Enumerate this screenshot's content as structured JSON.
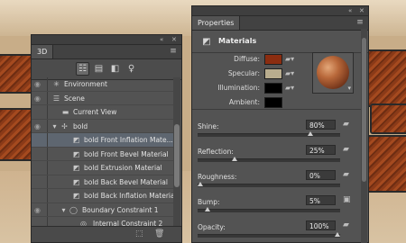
{
  "panel_3d": {
    "tab": "3D",
    "rows": [
      {
        "label": "Environment",
        "icon": "environment-icon",
        "indent": 0
      },
      {
        "label": "Scene",
        "icon": "scene-icon",
        "indent": 0
      },
      {
        "label": "Current View",
        "icon": "camera-icon",
        "indent": 1
      },
      {
        "label": "bold",
        "icon": "mesh-icon",
        "indent": 1
      },
      {
        "label": "bold Front Inflation Mate...",
        "icon": "material-icon",
        "indent": 2
      },
      {
        "label": "bold Front Bevel Material",
        "icon": "material-icon",
        "indent": 2
      },
      {
        "label": "bold Extrusion Material",
        "icon": "material-icon",
        "indent": 2
      },
      {
        "label": "bold Back Bevel Material",
        "icon": "material-icon",
        "indent": 2
      },
      {
        "label": "bold Back Inflation Material",
        "icon": "material-icon",
        "indent": 2
      },
      {
        "label": "Boundary Constraint 1",
        "icon": "constraint-icon",
        "indent": 1
      },
      {
        "label": "Internal Constraint 2",
        "icon": "constraint-icon",
        "indent": 2
      }
    ]
  },
  "properties": {
    "tab": "Properties",
    "title": "Materials",
    "swatches": [
      {
        "label": "Diffuse:",
        "color": "#8b2d10"
      },
      {
        "label": "Specular:",
        "color": "#b9ad8e"
      },
      {
        "label": "Illumination:",
        "color": "#000000"
      },
      {
        "label": "Ambient:",
        "color": "#000000"
      }
    ],
    "params": [
      {
        "label": "Shine:",
        "value": "80%",
        "level": 0.8
      },
      {
        "label": "Reflection:",
        "value": "25%",
        "level": 0.25
      },
      {
        "label": "Roughness:",
        "value": "0%",
        "level": 0.0
      },
      {
        "label": "Bump:",
        "value": "5%",
        "level": 0.05
      },
      {
        "label": "Opacity:",
        "value": "100%",
        "level": 1.0
      }
    ]
  }
}
